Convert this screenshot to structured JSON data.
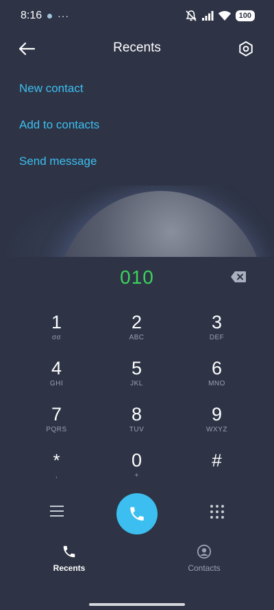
{
  "status_bar": {
    "time": "8:16",
    "more": "···",
    "battery": "100"
  },
  "header": {
    "title": "Recents"
  },
  "actions": [
    {
      "label": "New contact"
    },
    {
      "label": "Add to contacts"
    },
    {
      "label": "Send message"
    }
  ],
  "dial": {
    "number": "010"
  },
  "keys": [
    {
      "digit": "1",
      "sub": "σσ"
    },
    {
      "digit": "2",
      "sub": "ABC"
    },
    {
      "digit": "3",
      "sub": "DEF"
    },
    {
      "digit": "4",
      "sub": "GHI"
    },
    {
      "digit": "5",
      "sub": "JKL"
    },
    {
      "digit": "6",
      "sub": "MNO"
    },
    {
      "digit": "7",
      "sub": "PQRS"
    },
    {
      "digit": "8",
      "sub": "TUV"
    },
    {
      "digit": "9",
      "sub": "WXYZ"
    },
    {
      "digit": "*",
      "sub": ","
    },
    {
      "digit": "0",
      "sub": "+"
    },
    {
      "digit": "#",
      "sub": ""
    }
  ],
  "bottom_nav": {
    "recents": "Recents",
    "contacts": "Contacts"
  },
  "colors": {
    "background": "#2e3446",
    "accent": "#3cbff0",
    "dial_number": "#3bd35c"
  }
}
